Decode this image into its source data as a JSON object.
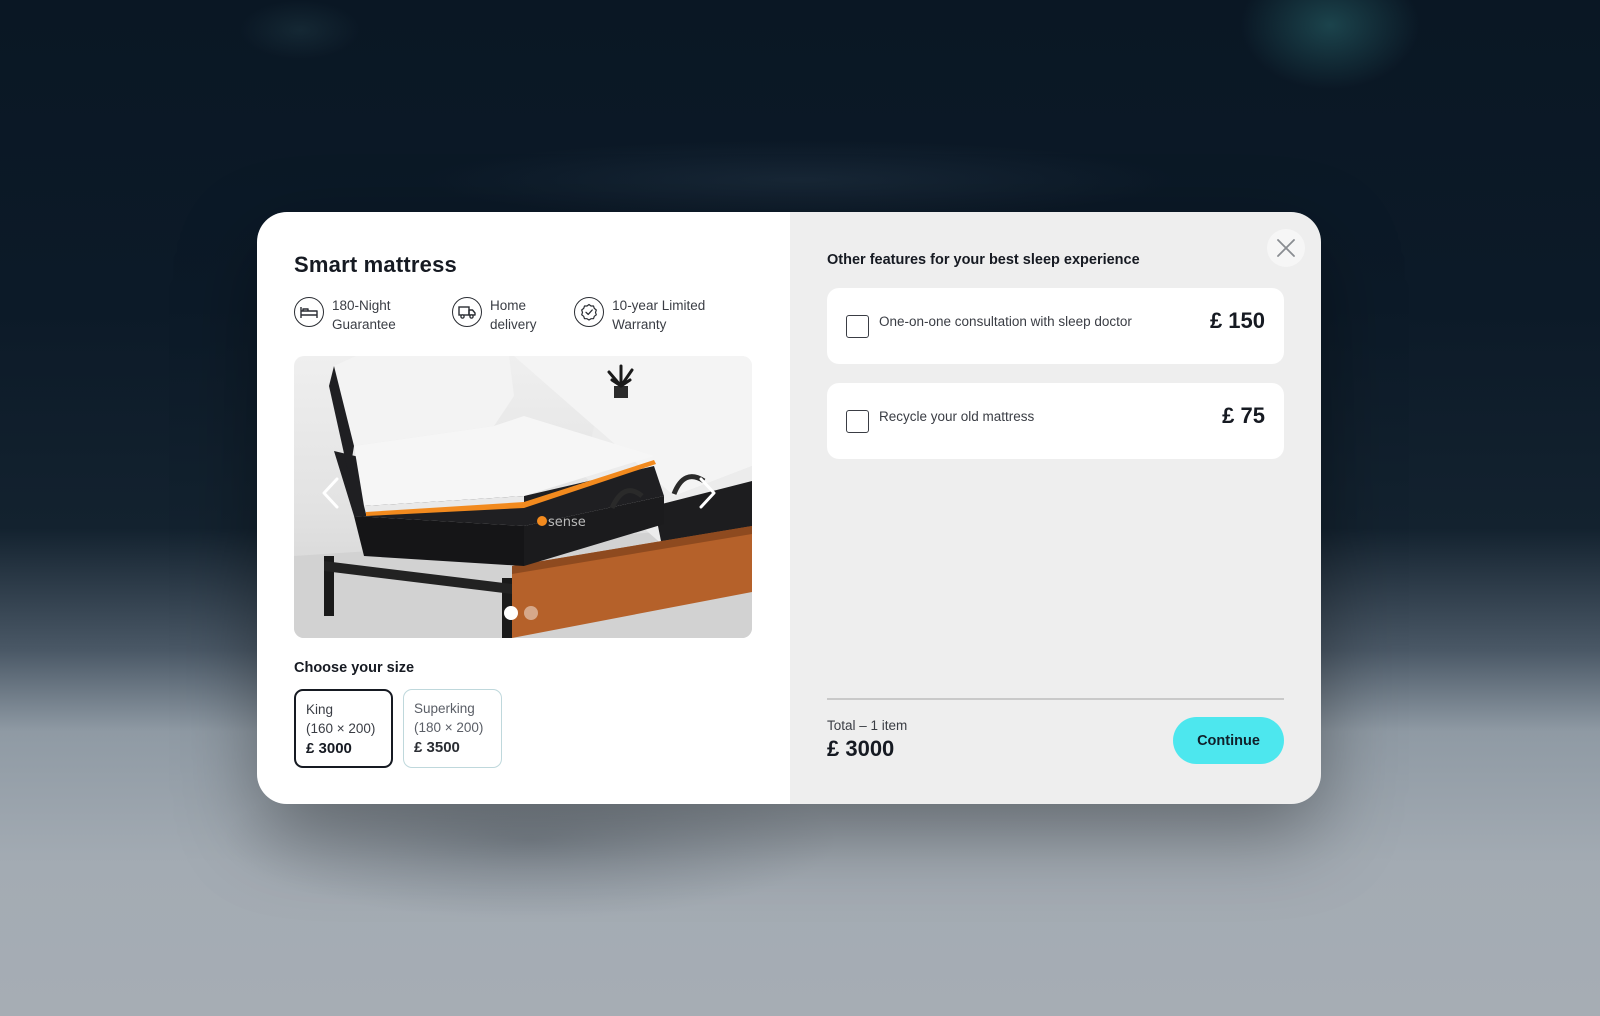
{
  "product": {
    "title": "Smart mattress",
    "features": [
      {
        "icon": "bed-icon",
        "line1": "180-Night",
        "line2": "Guarantee"
      },
      {
        "icon": "truck-icon",
        "line1": "Home",
        "line2": "delivery"
      },
      {
        "icon": "badge-check-icon",
        "line1": "10-year Limited",
        "line2": "Warranty"
      }
    ],
    "gallery": {
      "slide_count": 2,
      "active_slide": 1,
      "image_brand_text": "sense"
    }
  },
  "size": {
    "heading": "Choose your size",
    "options": [
      {
        "name": "King",
        "dimensions": "(160 × 200)",
        "price": "£ 3000",
        "selected": true
      },
      {
        "name": "Superking",
        "dimensions": "(180 × 200)",
        "price": "£ 3500",
        "selected": false
      }
    ]
  },
  "extras": {
    "heading": "Other features for your best sleep experience",
    "options": [
      {
        "label": "One-on-one consultation with sleep doctor",
        "price": "£ 150",
        "checked": false
      },
      {
        "label": "Recycle your old mattress",
        "price": "£ 75",
        "checked": false
      }
    ]
  },
  "summary": {
    "total_label": "Total – 1 item",
    "total_value": "£ 3000",
    "continue_label": "Continue"
  },
  "colors": {
    "accent": "#4de7ee",
    "selected_border": "#161a22",
    "unselected_border": "#bfd8dc",
    "wood": "#b5612a",
    "brand_orange": "#f28a1e"
  }
}
